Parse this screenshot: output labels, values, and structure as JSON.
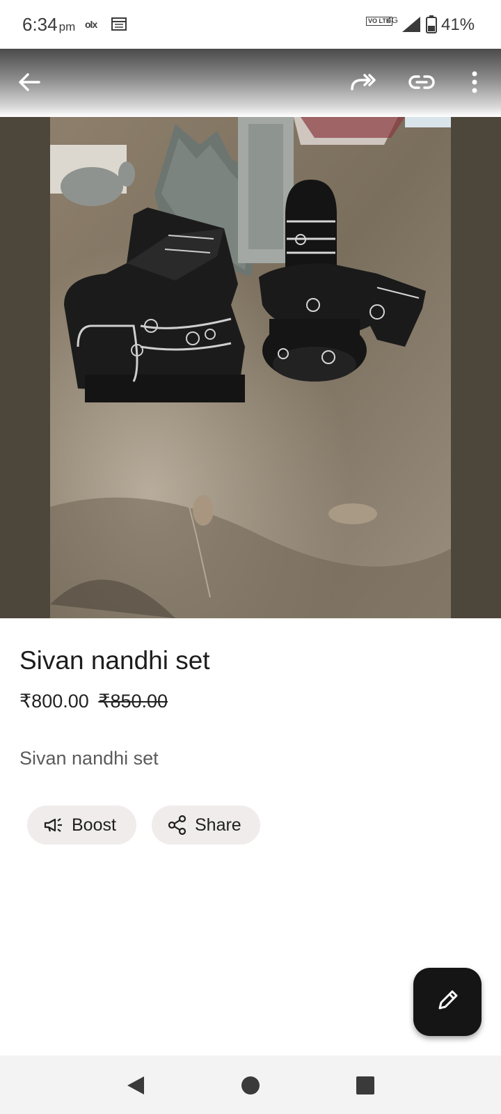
{
  "status": {
    "time": "6:34",
    "ampm": "pm",
    "olx": "olx",
    "volte": "VO LTE",
    "network": "4G",
    "battery": "41%"
  },
  "product": {
    "title": "Sivan nandhi set",
    "price": "₹800.00",
    "original_price": "₹850.00",
    "description": "Sivan nandhi set"
  },
  "actions": {
    "boost": "Boost",
    "share": "Share"
  },
  "icons": [
    "back-arrow-icon",
    "forward-share-icon",
    "link-icon",
    "more-vert-icon",
    "megaphone-icon",
    "share-icon",
    "edit-pencil-icon"
  ]
}
